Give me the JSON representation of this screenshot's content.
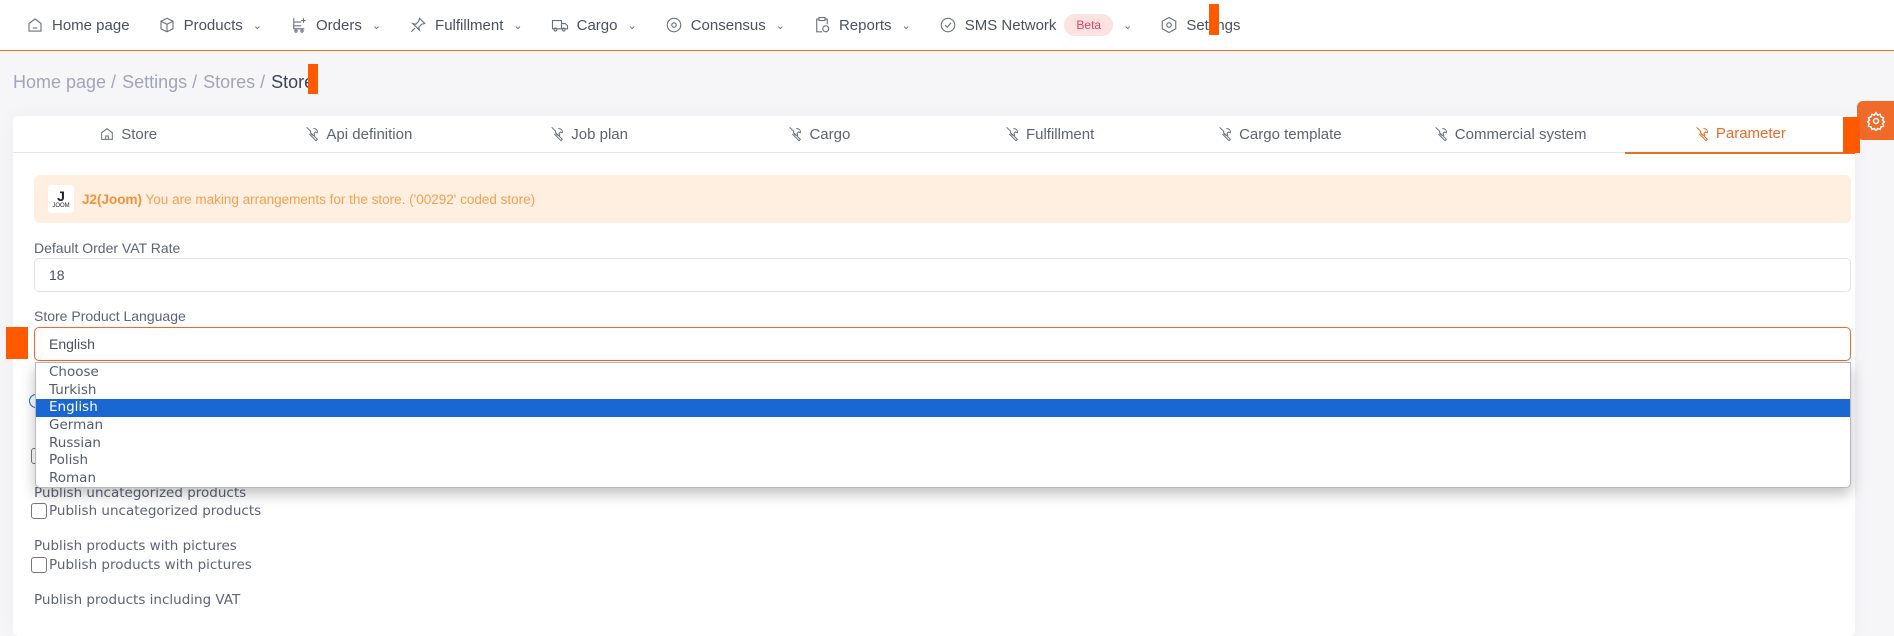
{
  "nav": {
    "items": [
      {
        "label": "Home page",
        "icon": "home-icon",
        "dropdown": false
      },
      {
        "label": "Products",
        "icon": "box-icon",
        "dropdown": true
      },
      {
        "label": "Orders",
        "icon": "cart-icon",
        "dropdown": true
      },
      {
        "label": "Fulfillment",
        "icon": "pin-icon",
        "dropdown": true
      },
      {
        "label": "Cargo",
        "icon": "truck-icon",
        "dropdown": true
      },
      {
        "label": "Consensus",
        "icon": "target-icon",
        "dropdown": true
      },
      {
        "label": "Reports",
        "icon": "clipboard-icon",
        "dropdown": true
      },
      {
        "label": "SMS Network",
        "icon": "check-circle-icon",
        "dropdown": true,
        "badge": "Beta"
      },
      {
        "label": "Settings",
        "icon": "settings-icon",
        "dropdown": false
      }
    ]
  },
  "breadcrumb": [
    "Home page /",
    "Settings /",
    "Stores /",
    "Store"
  ],
  "tabs": [
    "Store",
    "Api definition",
    "Job plan",
    "Cargo",
    "Fulfillment",
    "Cargo template",
    "Commercial system",
    "Parameter"
  ],
  "active_tab": "Parameter",
  "alert": {
    "logo_text": "JOOM",
    "logo_letter": "J",
    "store_name": "J2(Joom)",
    "message": "You are making arrangements for the store. ('00292' coded store)"
  },
  "form": {
    "vat_label": "Default Order VAT Rate",
    "vat_value": "18",
    "language_label": "Store Product Language",
    "language_value": "English",
    "language_options": [
      "Choose",
      "Turkish",
      "English",
      "German",
      "Russian",
      "Polish",
      "Roman"
    ],
    "uncategorized_label": "Publish uncategorized products",
    "uncategorized_checkbox": "Publish uncategorized products",
    "pictures_label": "Publish products with pictures",
    "pictures_checkbox": "Publish products with pictures",
    "vat_publish_label": "Publish products including VAT"
  },
  "colors": {
    "accent": "#f06a2a",
    "selected_option": "#1a66d2",
    "alert_bg": "#feefe1"
  }
}
